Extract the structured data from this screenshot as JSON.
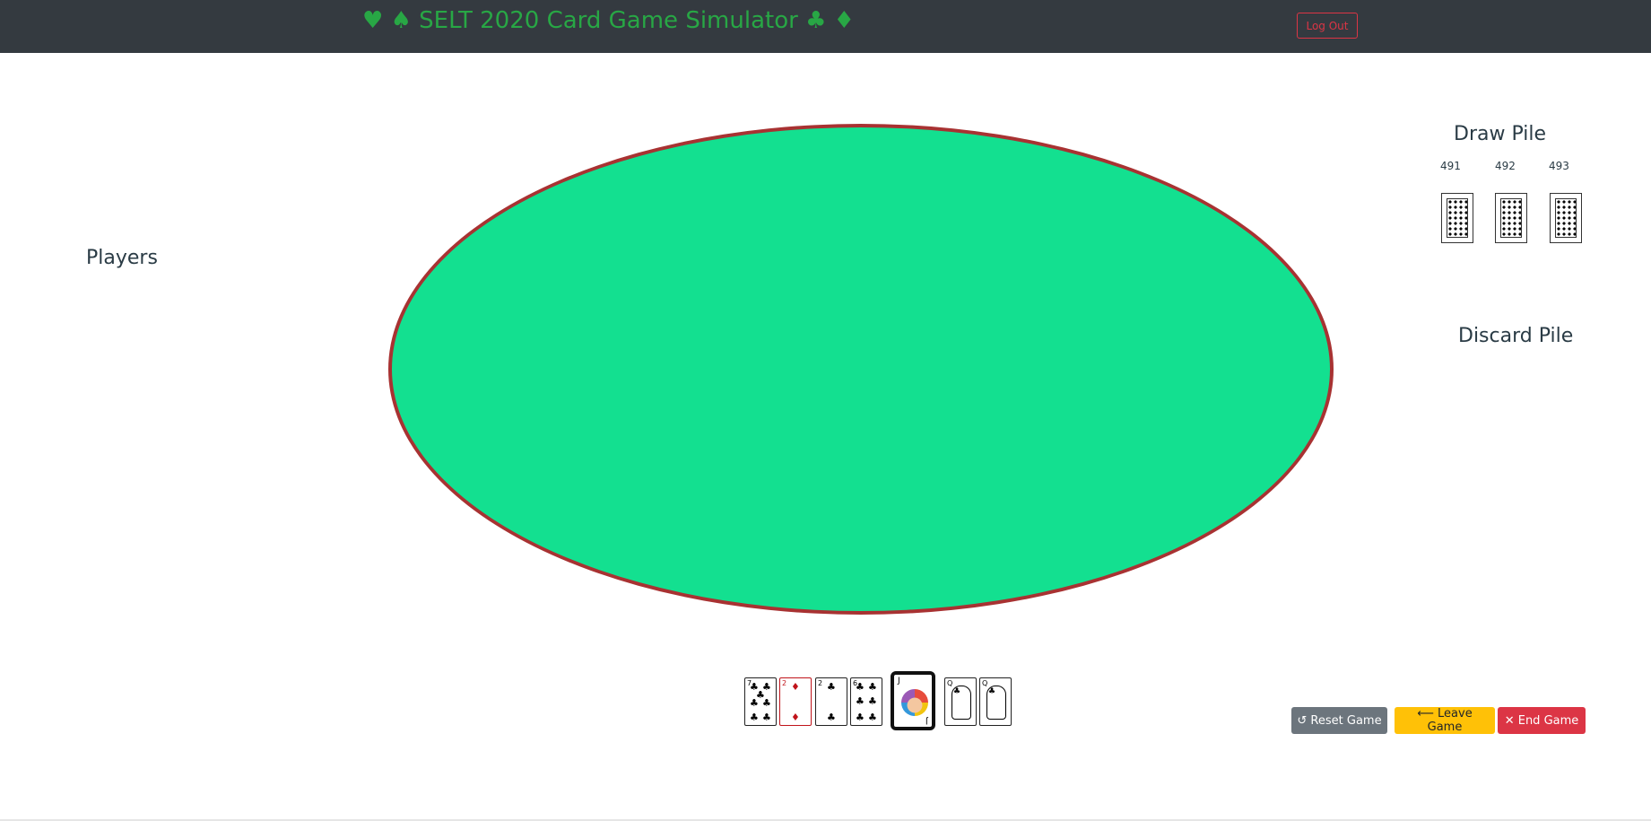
{
  "header": {
    "title": "♥ ♠ SELT 2020 Card Game Simulator ♣ ♦",
    "logout_label": "Log Out"
  },
  "players": {
    "title": "Players"
  },
  "draw_pile": {
    "title": "Draw Pile",
    "counts": [
      "491",
      "492",
      "493"
    ]
  },
  "discard_pile": {
    "title": "Discard Pile"
  },
  "hand": {
    "cards": [
      {
        "rank": "7",
        "suit": "♣",
        "color": "black"
      },
      {
        "rank": "2",
        "suit": "♦",
        "color": "red"
      },
      {
        "rank": "2",
        "suit": "♣",
        "color": "black"
      },
      {
        "rank": "6",
        "suit": "♣",
        "color": "black"
      },
      {
        "rank": "J",
        "suit": "joker",
        "color": "black",
        "selected": true
      },
      {
        "rank": "Q",
        "suit": "♣",
        "color": "black"
      },
      {
        "rank": "Q",
        "suit": "♣",
        "color": "black"
      }
    ]
  },
  "actions": {
    "reset_label": "↺ Reset Game",
    "leave_label": "⟵ Leave Game",
    "end_label": "✕ End Game"
  },
  "colors": {
    "navbar": "#343a40",
    "brand": "#28a745",
    "table_felt": "#13e090",
    "table_rim": "#a83232",
    "danger": "#dc3545",
    "warning": "#ffc107",
    "secondary": "#6c757d"
  }
}
